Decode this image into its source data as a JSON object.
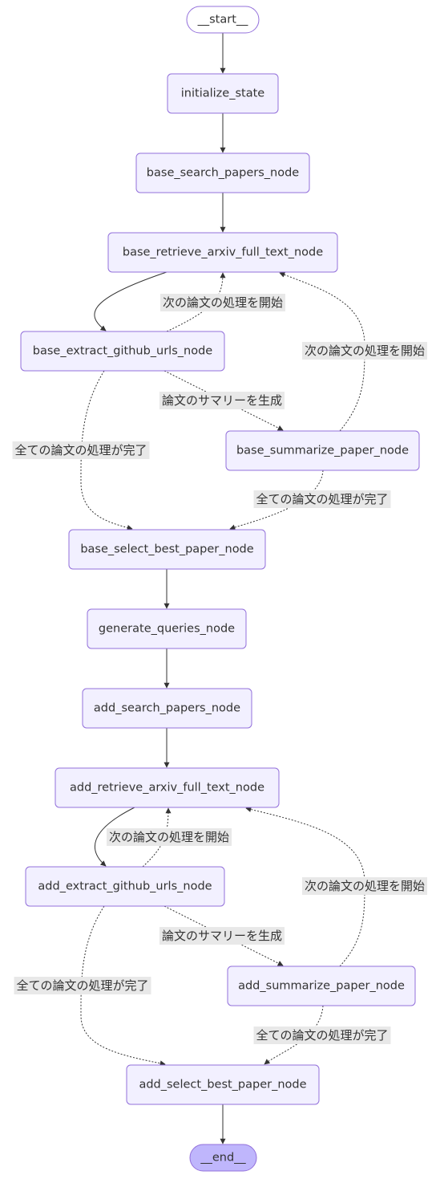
{
  "nodes": {
    "start": "__start__",
    "initialize_state": "initialize_state",
    "base_search_papers_node": "base_search_papers_node",
    "base_retrieve_arxiv_full_text_node": "base_retrieve_arxiv_full_text_node",
    "base_extract_github_urls_node": "base_extract_github_urls_node",
    "base_summarize_paper_node": "base_summarize_paper_node",
    "base_select_best_paper_node": "base_select_best_paper_node",
    "generate_queries_node": "generate_queries_node",
    "add_search_papers_node": "add_search_papers_node",
    "add_retrieve_arxiv_full_text_node": "add_retrieve_arxiv_full_text_node",
    "add_extract_github_urls_node": "add_extract_github_urls_node",
    "add_summarize_paper_node": "add_summarize_paper_node",
    "add_select_best_paper_node": "add_select_best_paper_node",
    "end": "__end__"
  },
  "edge_labels": {
    "next_paper": "次の論文の処理を開始",
    "summarize": "論文のサマリーを生成",
    "all_done": "全ての論文の処理が完了"
  },
  "colors": {
    "node_fill": "#f2f0ff",
    "node_stroke": "#9370db",
    "end_fill": "#bfb6fc",
    "edge_label_bg": "#e8e8e8"
  }
}
